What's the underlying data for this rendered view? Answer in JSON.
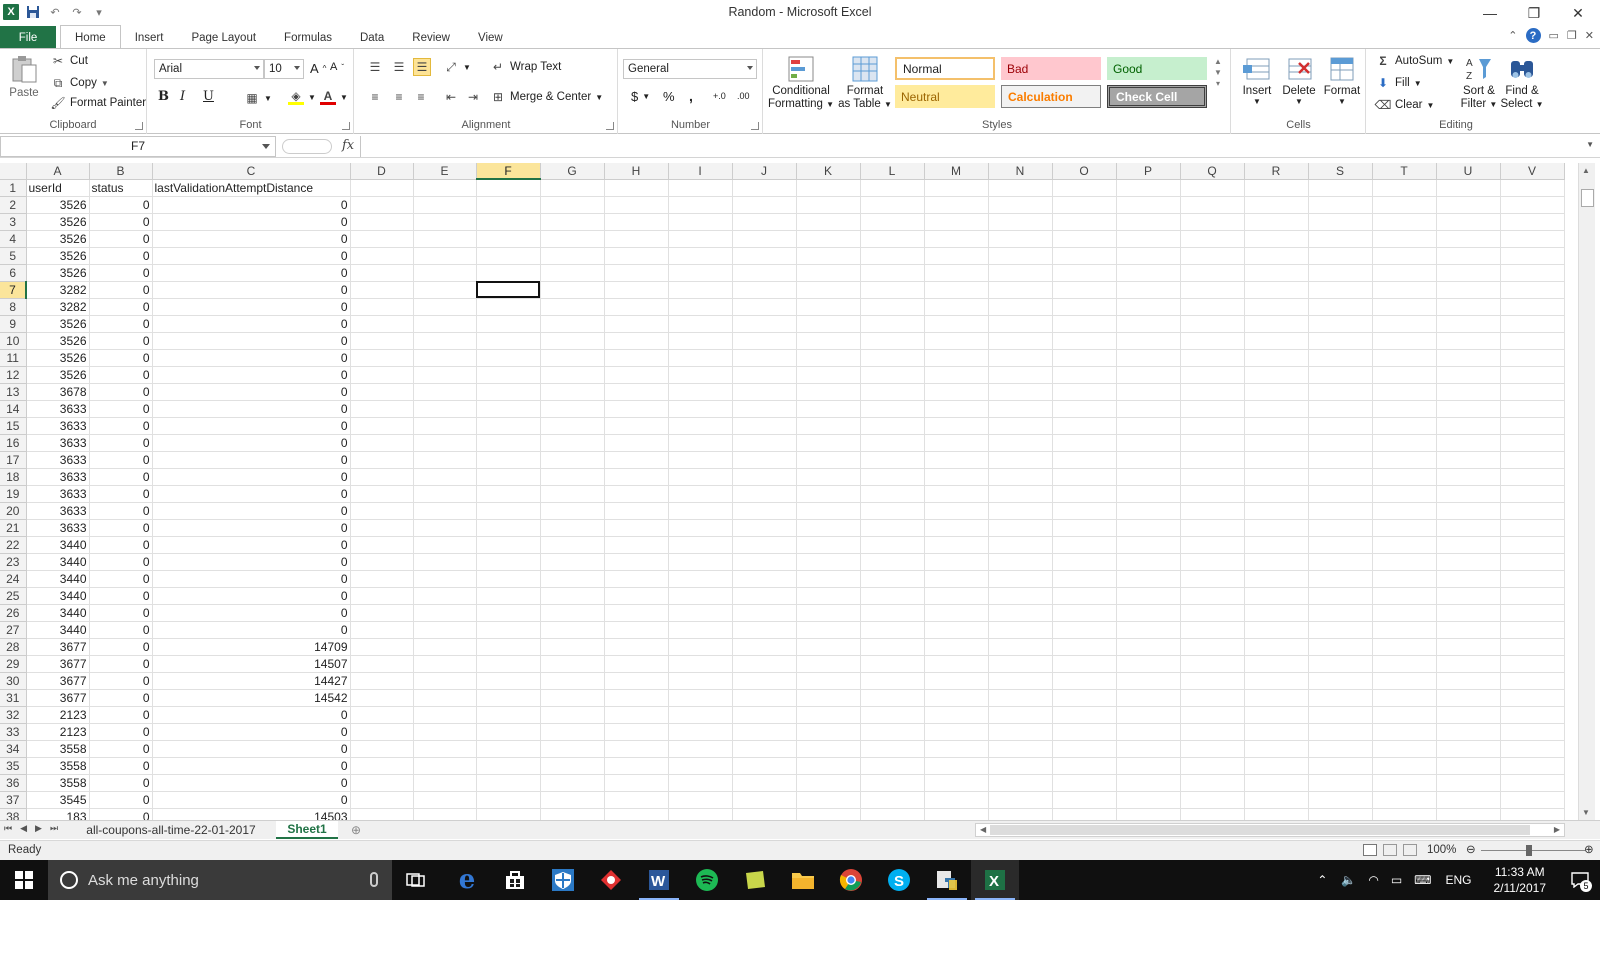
{
  "window": {
    "title": "Random  -  Microsoft Excel"
  },
  "quick_access": {
    "save": "save-icon",
    "undo": "undo-icon",
    "redo": "redo-icon"
  },
  "ribbon_tabs": [
    "File",
    "Home",
    "Insert",
    "Page Layout",
    "Formulas",
    "Data",
    "Review",
    "View"
  ],
  "clipboard": {
    "paste": "Paste",
    "cut": "Cut",
    "copy": "Copy",
    "format_painter": "Format Painter",
    "label": "Clipboard"
  },
  "font": {
    "name": "Arial",
    "size": "10",
    "bold": "B",
    "italic": "I",
    "underline": "U",
    "label": "Font"
  },
  "alignment": {
    "wrap_text": "Wrap Text",
    "merge_center": "Merge & Center",
    "label": "Alignment"
  },
  "number": {
    "format": "General",
    "currency": "$",
    "percent": "%",
    "comma": ",",
    "inc_decimal": "+.0",
    "dec_decimal": ".00",
    "label": "Number"
  },
  "styles": {
    "conditional_formatting": [
      "Conditional",
      "Formatting"
    ],
    "format_as_table": [
      "Format",
      "as Table"
    ],
    "normal": "Normal",
    "bad": "Bad",
    "good": "Good",
    "neutral": "Neutral",
    "calculation": "Calculation",
    "check_cell": "Check Cell",
    "label": "Styles"
  },
  "cells": {
    "insert": "Insert",
    "delete": "Delete",
    "format": "Format",
    "label": "Cells"
  },
  "editing": {
    "autosum": "AutoSum",
    "fill": "Fill",
    "clear": "Clear",
    "sort_filter": [
      "Sort &",
      "Filter"
    ],
    "find_select": [
      "Find &",
      "Select"
    ],
    "label": "Editing"
  },
  "formula_bar": {
    "name_box": "F7",
    "fx": "fx",
    "formula": ""
  },
  "grid": {
    "columns": [
      "A",
      "B",
      "C",
      "D",
      "E",
      "F",
      "G",
      "H",
      "I",
      "J",
      "K",
      "L",
      "M",
      "N",
      "O",
      "P",
      "Q",
      "R",
      "S",
      "T",
      "U",
      "V"
    ],
    "selected_column": "F",
    "selected_row": 7,
    "header_row": [
      "userId",
      "status",
      "lastValidationAttemptDistance"
    ],
    "rows": [
      [
        3526,
        0,
        0
      ],
      [
        3526,
        0,
        0
      ],
      [
        3526,
        0,
        0
      ],
      [
        3526,
        0,
        0
      ],
      [
        3526,
        0,
        0
      ],
      [
        3282,
        0,
        0
      ],
      [
        3282,
        0,
        0
      ],
      [
        3526,
        0,
        0
      ],
      [
        3526,
        0,
        0
      ],
      [
        3526,
        0,
        0
      ],
      [
        3526,
        0,
        0
      ],
      [
        3678,
        0,
        0
      ],
      [
        3633,
        0,
        0
      ],
      [
        3633,
        0,
        0
      ],
      [
        3633,
        0,
        0
      ],
      [
        3633,
        0,
        0
      ],
      [
        3633,
        0,
        0
      ],
      [
        3633,
        0,
        0
      ],
      [
        3633,
        0,
        0
      ],
      [
        3633,
        0,
        0
      ],
      [
        3440,
        0,
        0
      ],
      [
        3440,
        0,
        0
      ],
      [
        3440,
        0,
        0
      ],
      [
        3440,
        0,
        0
      ],
      [
        3440,
        0,
        0
      ],
      [
        3440,
        0,
        0
      ],
      [
        3677,
        0,
        14709
      ],
      [
        3677,
        0,
        14507
      ],
      [
        3677,
        0,
        14427
      ],
      [
        3677,
        0,
        14542
      ],
      [
        2123,
        0,
        0
      ],
      [
        2123,
        0,
        0
      ],
      [
        3558,
        0,
        0
      ],
      [
        3558,
        0,
        0
      ],
      [
        3558,
        0,
        0
      ],
      [
        3545,
        0,
        0
      ],
      [
        183,
        0,
        14503
      ]
    ]
  },
  "sheets": [
    {
      "name": "all-coupons-all-time-22-01-2017",
      "active": false
    },
    {
      "name": "Sheet1",
      "active": true
    }
  ],
  "status_bar": {
    "status": "Ready",
    "zoom": "100%"
  },
  "taskbar": {
    "search_placeholder": "Ask me anything",
    "language": "ENG",
    "time": "11:33 AM",
    "date": "2/11/2017",
    "notifications": "5",
    "apps": [
      "task-view-icon",
      "edge-icon",
      "store-icon",
      "security-icon",
      "app-red-icon",
      "word-icon",
      "spotify-icon",
      "notes-icon",
      "file-explorer-icon",
      "chrome-icon",
      "skype-icon",
      "python-icon",
      "excel-icon"
    ]
  },
  "colors": {
    "excel_green": "#217346",
    "selected_header": "#fbe59b",
    "style_bad": "#ffc7ce",
    "style_good": "#c6efce",
    "style_neutral": "#ffeb9c"
  }
}
